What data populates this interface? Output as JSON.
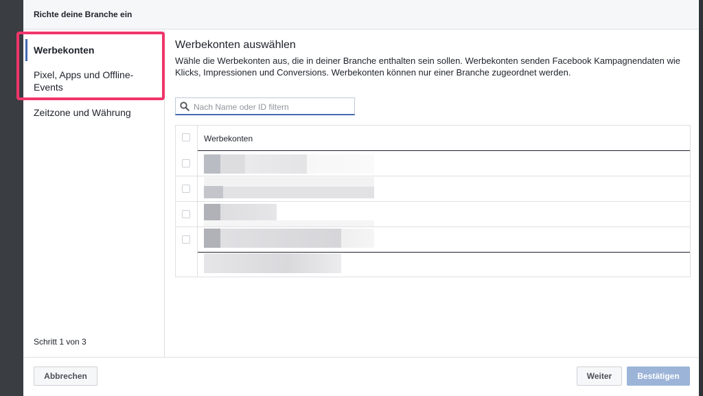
{
  "dialog": {
    "title": "Richte deine Branche ein"
  },
  "sidebar": {
    "items": [
      {
        "label": "Werbekonten",
        "active": true
      },
      {
        "label": "Pixel, Apps und Offline-Events",
        "active": false
      },
      {
        "label": "Zeitzone und Währung",
        "active": false
      }
    ],
    "step": "Schritt 1 von 3"
  },
  "main": {
    "heading": "Werbekonten auswählen",
    "description": "Wähle die Werbekonten aus, die in deiner Branche enthalten sein sollen. Werbekonten senden Facebook Kampagnendaten wie Klicks, Impressionen und Conversions. Werbekonten können nur einer Branche zugeordnet werden.",
    "search": {
      "placeholder": "Nach Name oder ID filtern",
      "value": ""
    },
    "table": {
      "column": "Werbekonten",
      "rows": 4
    }
  },
  "footer": {
    "cancel": "Abbrechen",
    "next": "Weiter",
    "confirm": "Bestätigen"
  },
  "colors": {
    "accent": "#4267b2",
    "highlight": "#f0356a",
    "confirm_disabled": "#9cb4d8"
  },
  "icons": [
    "search-icon"
  ]
}
